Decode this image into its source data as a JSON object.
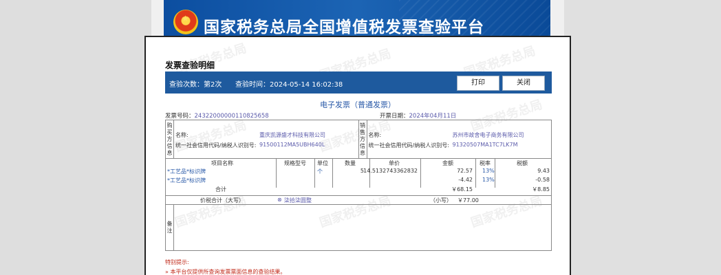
{
  "banner": {
    "title": "国家税务总局全国增值税发票查验平台",
    "emblem": "national-emblem-icon"
  },
  "watermark_text": "国家税务总局",
  "dialog": {
    "title": "发票查验明细",
    "check_count_label": "查验次数：第2次",
    "check_time_label": "查验时间：2024-05-14 16:02:38",
    "print_button": "打印",
    "close_button": "关闭"
  },
  "invoice": {
    "title": "电子发票（普通发票）",
    "number_label": "发票号码：",
    "number": "24322000000110825658",
    "date_label": "开票日期：",
    "date": "2024年04月11日",
    "buyer": {
      "side_label": "购\n买\n方\n信\n息",
      "name_label": "名称:",
      "name": "重庆凯源盛才科技有限公司",
      "id_label": "统一社会信用代码/纳税人识别号:",
      "id": "91500112MA5UBH640L"
    },
    "seller": {
      "side_label": "销\n售\n方\n信\n息",
      "name_label": "名称:",
      "name": "苏州市故舍电子商务有限公司",
      "id_label": "统一社会信用代码/纳税人识别号:",
      "id": "91320507MA1TC7LK7M"
    },
    "columns": {
      "item": "项目名称",
      "spec": "规格型号",
      "unit": "单位",
      "qty": "数量",
      "price": "单价",
      "amount": "金额",
      "rate": "税率",
      "tax": "税额"
    },
    "rows": [
      {
        "item": "*工艺品*标识牌",
        "unit": "个",
        "qty": "5",
        "price": "14.5132743362832",
        "amount": "72.57",
        "rate": "13%",
        "tax": "9.43"
      },
      {
        "item": "*工艺品*标识牌",
        "unit": "",
        "qty": "",
        "price": "",
        "amount": "-4.42",
        "rate": "13%",
        "tax": "-0.58"
      }
    ],
    "subtotal_label": "合计",
    "subtotal_amount": "￥68.15",
    "subtotal_tax": "￥8.85",
    "total_label": "价税合计（大写）",
    "total_upper_icon": "cross-circle-icon",
    "total_upper": "柒拾柒圆整",
    "total_small_label": "（小写）",
    "total_small": "￥77.00",
    "remark_label": "备\n注"
  },
  "tips": {
    "title": "特别提示:",
    "line1": "» 本平台仅提供所查询发票票面信息的查验结果。"
  }
}
